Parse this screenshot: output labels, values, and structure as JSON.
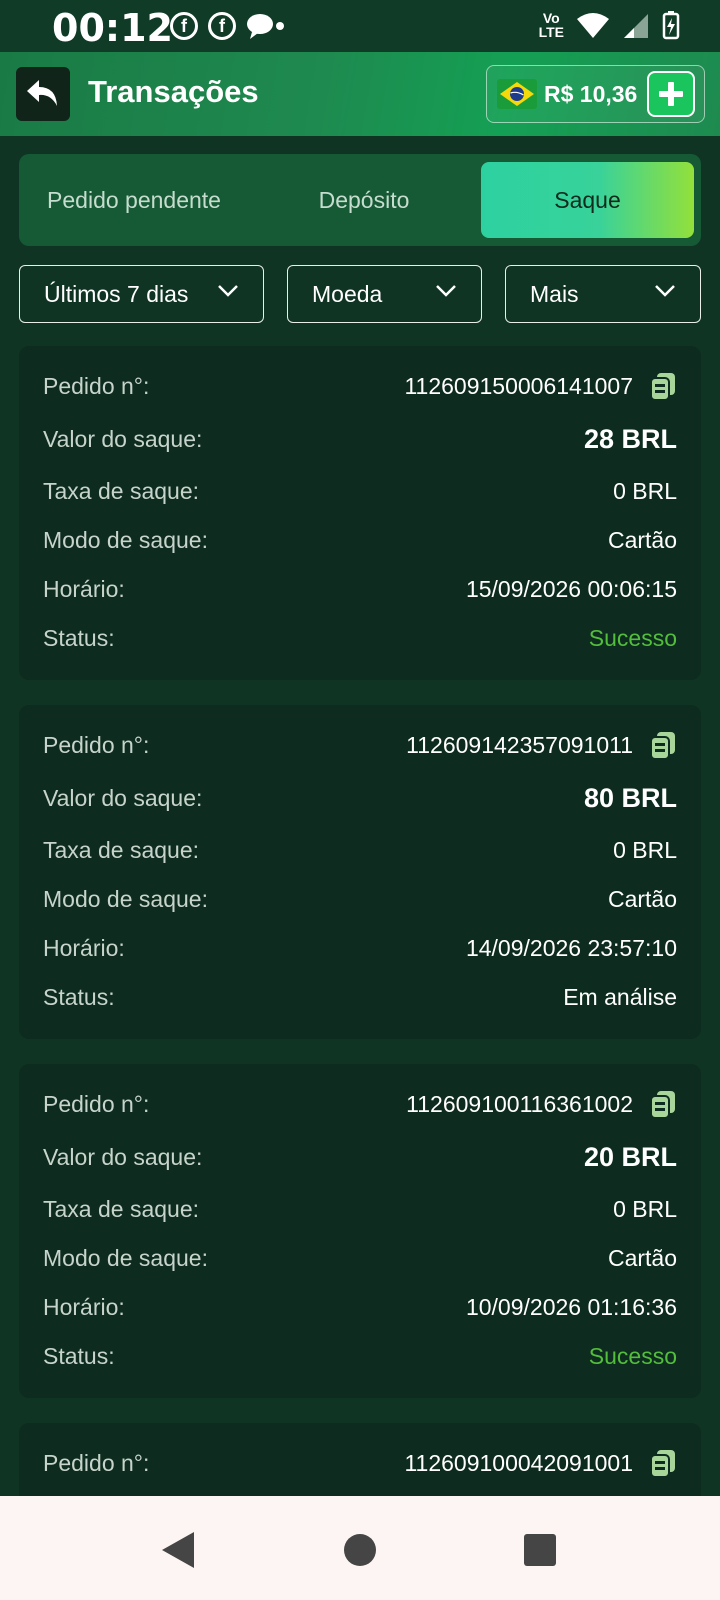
{
  "status_bar": {
    "time": "00:12",
    "network": "Vo LTE"
  },
  "header": {
    "title": "Transações",
    "balance": "R$ 10,36"
  },
  "tabs": [
    {
      "label": "Pedido pendente",
      "active": false
    },
    {
      "label": "Depósito",
      "active": false
    },
    {
      "label": "Saque",
      "active": true
    }
  ],
  "filters": {
    "period": "Últimos 7 dias",
    "currency": "Moeda",
    "more": "Mais"
  },
  "labels": {
    "order": "Pedido n°:",
    "amount": "Valor do saque:",
    "fee": "Taxa de saque:",
    "mode": "Modo de saque:",
    "time": "Horário:",
    "status": "Status:"
  },
  "transactions": [
    {
      "order": "112609150006141007",
      "amount": "28 BRL",
      "fee": "0 BRL",
      "mode": "Cartão",
      "time": "15/09/2026 00:06:15",
      "status": "Sucesso"
    },
    {
      "order": "112609142357091011",
      "amount": "80 BRL",
      "fee": "0 BRL",
      "mode": "Cartão",
      "time": "14/09/2026 23:57:10",
      "status": "Em análise"
    },
    {
      "order": "112609100116361002",
      "amount": "20 BRL",
      "fee": "0 BRL",
      "mode": "Cartão",
      "time": "10/09/2026 01:16:36",
      "status": "Sucesso"
    },
    {
      "order": "112609100042091001"
    }
  ],
  "colors": {
    "success": "#53bd3c",
    "accent": "#19c55c",
    "background": "#103424"
  }
}
